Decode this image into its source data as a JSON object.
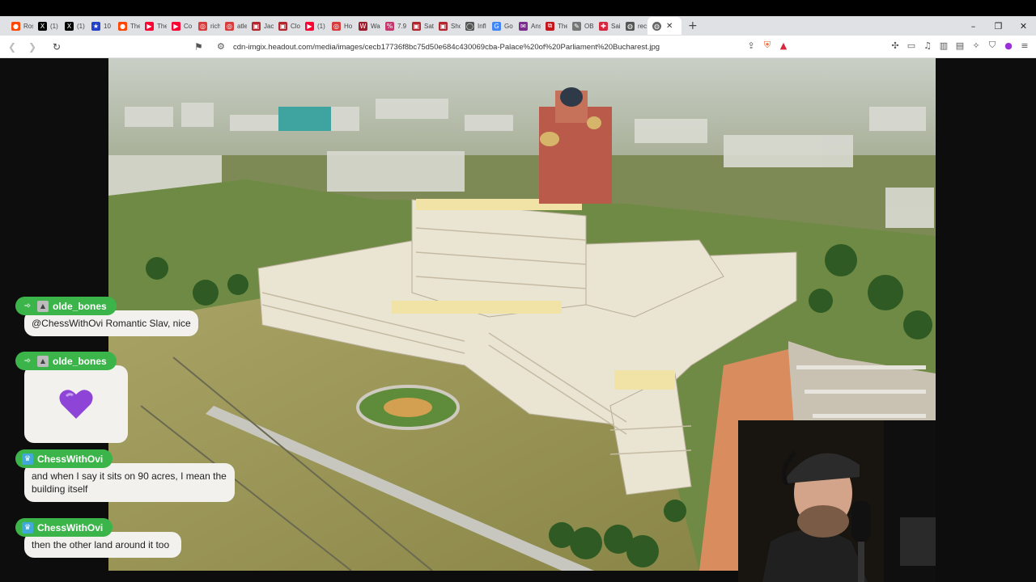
{
  "browser": {
    "tabs": [
      {
        "title": "Ros",
        "icon": "reddit-icon",
        "color": "#ff4500"
      },
      {
        "title": "(1)",
        "icon": "x-icon",
        "color": "#000000"
      },
      {
        "title": "(1)",
        "icon": "x-icon",
        "color": "#000000"
      },
      {
        "title": "10",
        "icon": "star-icon",
        "color": "#2340c9"
      },
      {
        "title": "The",
        "icon": "reddit-icon",
        "color": "#ff4500"
      },
      {
        "title": "The",
        "icon": "youtube-icon",
        "color": "#ff0033"
      },
      {
        "title": "Co",
        "icon": "youtube-icon",
        "color": "#ff0033"
      },
      {
        "title": "rich",
        "icon": "target-icon",
        "color": "#d93c3c"
      },
      {
        "title": "atle",
        "icon": "target-icon",
        "color": "#d93c3c"
      },
      {
        "title": "Jac",
        "icon": "page-icon",
        "color": "#b3262d"
      },
      {
        "title": "Clo",
        "icon": "page-icon",
        "color": "#b3262d"
      },
      {
        "title": "(1)",
        "icon": "youtube-icon",
        "color": "#ff0033"
      },
      {
        "title": "Ho",
        "icon": "target-icon",
        "color": "#d93c3c"
      },
      {
        "title": "Wa",
        "icon": "w-icon",
        "color": "#9d1c2a"
      },
      {
        "title": "7.9",
        "icon": "percent-icon",
        "color": "#c7366f"
      },
      {
        "title": "Sat",
        "icon": "page-icon",
        "color": "#b3262d"
      },
      {
        "title": "Sho",
        "icon": "page-icon",
        "color": "#b3262d"
      },
      {
        "title": "Infl",
        "icon": "ring-icon",
        "color": "#555555"
      },
      {
        "title": "Go",
        "icon": "google-icon",
        "color": "#4285f4"
      },
      {
        "title": "Ans",
        "icon": "mail-icon",
        "color": "#7b2d8e"
      },
      {
        "title": "The",
        "icon": "pdf-icon",
        "color": "#c4161c"
      },
      {
        "title": "OB",
        "icon": "edit-icon",
        "color": "#777777"
      },
      {
        "title": "Sai",
        "icon": "cross-icon",
        "color": "#d6273e"
      },
      {
        "title": "rec",
        "icon": "globe-icon",
        "color": "#555555"
      }
    ],
    "active_tab": {
      "icon": "globe-icon",
      "close_symbol": "✕"
    },
    "new_tab_symbol": "+",
    "window_controls": {
      "minimize": "–",
      "restore": "❐",
      "close": "✕"
    },
    "url": "cdn-imgix.headout.com/media/images/cecb17736f8bc75d50e684c430069cba-Palace%20of%20Parliament%20Bucharest.jpg"
  },
  "chat": [
    {
      "user": "olde_bones",
      "user_color": "#3bb54a",
      "badges": [
        "tank-icon",
        "triangle-icon"
      ],
      "message": "@ChessWithOvi Romantic Slav, nice"
    },
    {
      "user": "olde_bones",
      "user_color": "#3bb54a",
      "badges": [
        "tank-icon",
        "triangle-icon"
      ],
      "emote": "purple-heart",
      "emote_color": "#8e44d6"
    },
    {
      "user": "ChessWithOvi",
      "user_color": "#3bb54a",
      "badges": [
        "crown-icon"
      ],
      "message": "and when I say it sits on 90 acres, I mean the building itself"
    },
    {
      "user": "ChessWithOvi",
      "user_color": "#3bb54a",
      "badges": [
        "crown-icon"
      ],
      "message": "then the other land around it too"
    }
  ]
}
